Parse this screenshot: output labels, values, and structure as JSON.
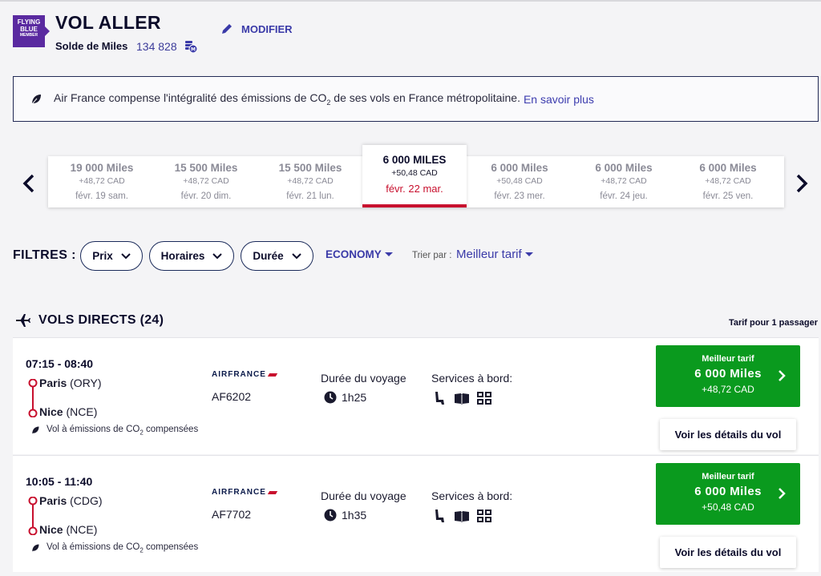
{
  "header": {
    "logo": {
      "line1": "FLYING",
      "line2": "BLUE",
      "line3": "MEMBER"
    },
    "title": "VOL ALLER",
    "miles_label": "Solde de Miles",
    "miles_value": "134 828",
    "modify_label": "MODIFIER"
  },
  "banner": {
    "text_before": "Air France compense l'intégralité des émissions de CO",
    "sub": "2",
    "text_after": " de ses vols en France métropolitaine.",
    "link": "En savoir plus"
  },
  "dates": [
    {
      "miles": "19 000  Miles",
      "cad": "+48,72 CAD",
      "day": "févr. 19 sam."
    },
    {
      "miles": "15 500  Miles",
      "cad": "+48,72 CAD",
      "day": "févr. 20 dim."
    },
    {
      "miles": "15 500  Miles",
      "cad": "+48,72 CAD",
      "day": "févr. 21 lun."
    },
    {
      "miles": "6 000  MILES",
      "cad": "+50,48 CAD",
      "day": "févr. 22 mar."
    },
    {
      "miles": "6 000  Miles",
      "cad": "+50,48 CAD",
      "day": "févr. 23 mer."
    },
    {
      "miles": "6 000  Miles",
      "cad": "+48,72 CAD",
      "day": "févr. 24 jeu."
    },
    {
      "miles": "6 000  Miles",
      "cad": "+48,72 CAD",
      "day": "févr. 25 ven."
    }
  ],
  "filters": {
    "label": "FILTRES :",
    "pills": [
      "Prix",
      "Horaires",
      "Durée"
    ],
    "cabin": "ECONOMY",
    "sort_label": "Trier par :",
    "sort_value": "Meilleur tarif"
  },
  "section": {
    "title": "VOLS DIRECTS (24)",
    "pax_note": "Tarif pour 1 passager"
  },
  "flights": [
    {
      "times": "07:15 - 08:40",
      "from_city": "Paris",
      "from_code": " (ORY)",
      "to_city": "Nice",
      "to_code": " (NCE)",
      "co2_before": "Vol à émissions de CO",
      "co2_sub": "2",
      "co2_after": " compensées",
      "airline": "AIRFRANCE",
      "flight_no": "AF6202",
      "duration_label": "Durée du voyage",
      "duration": "1h25",
      "services_label": "Services à bord:",
      "price_label": "Meilleur tarif",
      "price_miles": "6 000  Miles",
      "price_cad": "+48,72 CAD",
      "details_label": "Voir les détails du vol"
    },
    {
      "times": "10:05 - 11:40",
      "from_city": "Paris",
      "from_code": " (CDG)",
      "to_city": "Nice",
      "to_code": " (NCE)",
      "co2_before": "Vol à émissions de CO",
      "co2_sub": "2",
      "co2_after": " compensées",
      "airline": "AIRFRANCE",
      "flight_no": "AF7702",
      "duration_label": "Durée du voyage",
      "duration": "1h35",
      "services_label": "Services à bord:",
      "price_label": "Meilleur tarif",
      "price_miles": "6 000  Miles",
      "price_cad": "+50,48 CAD",
      "details_label": "Voir les détails du vol"
    }
  ],
  "colors": {
    "accent": "#3a3aa8",
    "price_green": "#0a9a1e",
    "selected_red": "#c8102e",
    "brand_purple": "#5a2aa0"
  }
}
